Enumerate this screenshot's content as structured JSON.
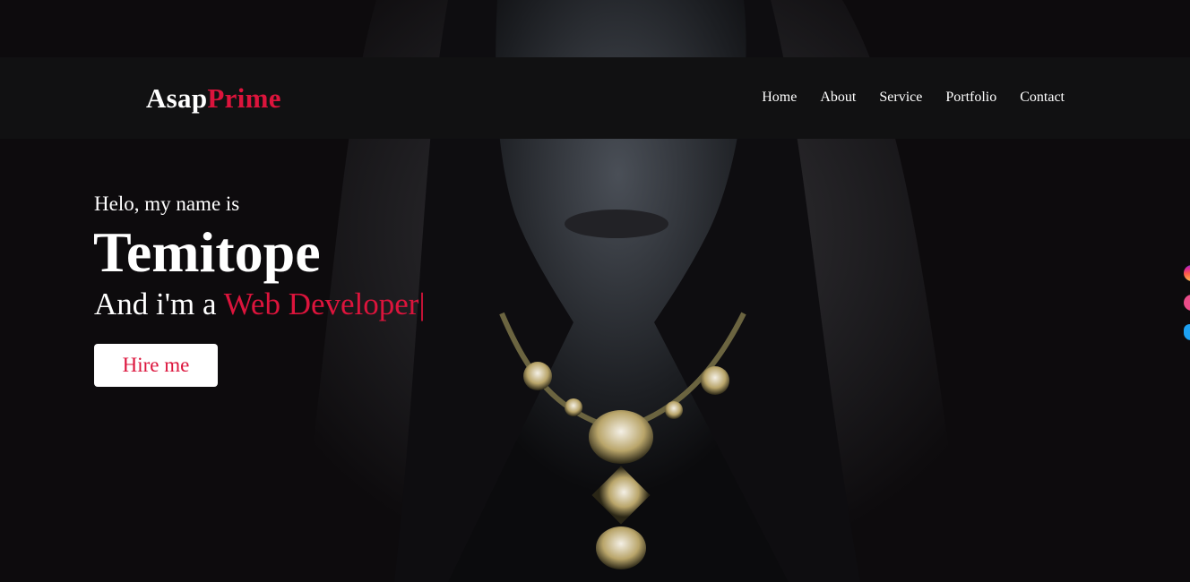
{
  "brand": {
    "first": "Asap",
    "second": "Prime"
  },
  "nav": {
    "items": [
      {
        "label": "Home"
      },
      {
        "label": "About"
      },
      {
        "label": "Service"
      },
      {
        "label": "Portfolio"
      },
      {
        "label": "Contact"
      }
    ]
  },
  "hero": {
    "greeting": "Helo, my name is",
    "name": "Temitope",
    "role_prefix": "And i'm a ",
    "role_typed": "Web Developer",
    "cursor": "|",
    "cta_label": "Hire me"
  },
  "social": {
    "icons": [
      "instagram-icon",
      "dribbble-icon",
      "twitter-icon"
    ]
  },
  "colors": {
    "accent": "#dc143c",
    "background": "#0d0b0d",
    "navbar": "#111112",
    "text": "#ffffff"
  }
}
